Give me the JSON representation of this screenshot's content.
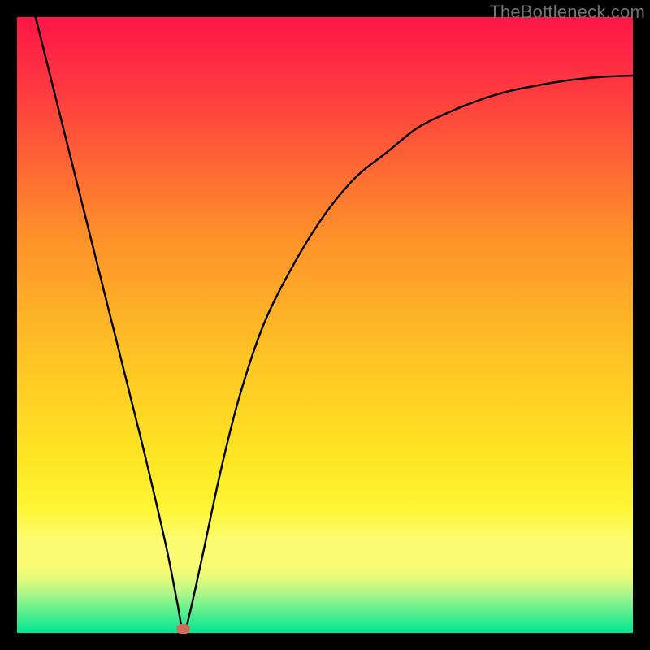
{
  "watermark": "TheBottleneck.com",
  "colors": {
    "top": "#fe1648",
    "mid_upper": "#fe8f2a",
    "mid": "#fee723",
    "band_light": "#fbfc71",
    "band_green_light": "#a4f58a",
    "bottom": "#02e692",
    "marker": "#cc6f59",
    "curve": "#000000"
  },
  "chart_data": {
    "type": "line",
    "title": "",
    "xlabel": "",
    "ylabel": "",
    "xlim": [
      0,
      100
    ],
    "ylim": [
      0,
      100
    ],
    "series": [
      {
        "name": "bottleneck-curve",
        "x": [
          3,
          5,
          10,
          15,
          20,
          24,
          26,
          27,
          28,
          30,
          33,
          36,
          40,
          45,
          50,
          55,
          60,
          65,
          70,
          75,
          80,
          85,
          90,
          95,
          100
        ],
        "y": [
          100,
          92,
          72,
          52,
          32,
          15,
          5,
          0,
          3,
          12,
          26,
          38,
          50,
          60,
          68,
          74,
          78,
          82,
          84.5,
          86.5,
          88,
          89,
          89.8,
          90.3,
          90.5
        ]
      }
    ],
    "marker": {
      "x": 27,
      "y": 0
    },
    "notes": "Axes are unlabeled; values are normalized 0-100. Curve minimum (optimal point) at x≈27, y=0. Background is vertical gradient from red (high bottleneck) through orange/yellow to green (no bottleneck)."
  }
}
